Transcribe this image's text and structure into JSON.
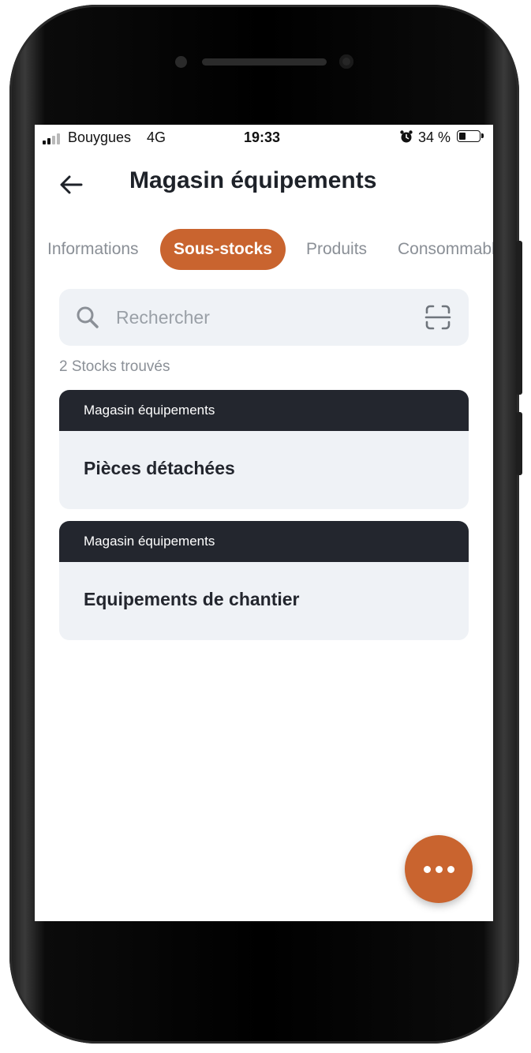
{
  "status_bar": {
    "carrier": "Bouygues",
    "network": "4G",
    "time": "19:33",
    "alarm_icon": "alarm-clock-icon",
    "battery_percent": "34 %",
    "battery_level": 0.34
  },
  "header": {
    "back_icon": "arrow-left-icon",
    "title": "Magasin équipements"
  },
  "tabs": [
    {
      "label": "Informations",
      "active": false
    },
    {
      "label": "Sous-stocks",
      "active": true
    },
    {
      "label": "Produits",
      "active": false
    },
    {
      "label": "Consommables",
      "active": false
    }
  ],
  "search": {
    "placeholder": "Rechercher",
    "value": "",
    "search_icon": "search-icon",
    "scan_icon": "scan-icon"
  },
  "results": {
    "count_text": "2 Stocks trouvés",
    "items": [
      {
        "parent": "Magasin équipements",
        "name": "Pièces détachées"
      },
      {
        "parent": "Magasin équipements",
        "name": "Equipements de chantier"
      }
    ]
  },
  "fab": {
    "icon": "more-horizontal-icon"
  },
  "colors": {
    "accent": "#c9642f",
    "card_header": "#23262e",
    "card_body": "#eff2f6",
    "muted_text": "#8a8f96"
  }
}
